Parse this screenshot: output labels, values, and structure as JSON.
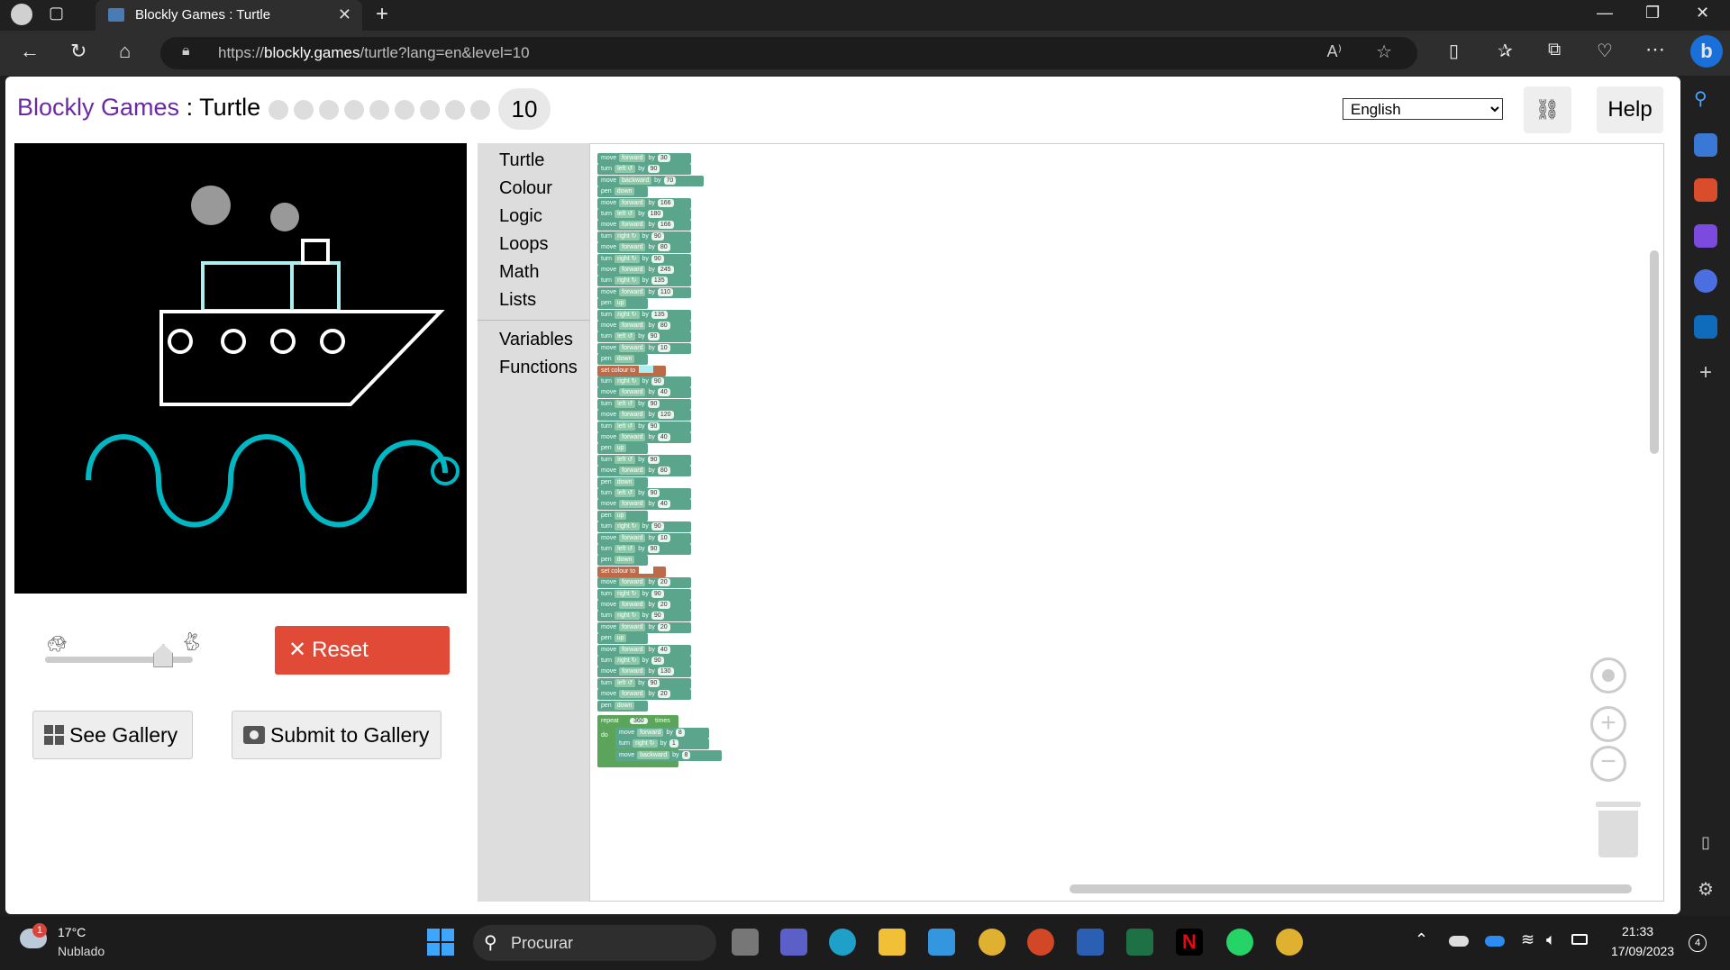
{
  "browser": {
    "tab_title": "Blockly Games : Turtle",
    "url_prefix": "https://",
    "url_domain": "blockly.games",
    "url_path": "/turtle?lang=en&level=10"
  },
  "header": {
    "games_link": "Blockly Games",
    "separator": " : ",
    "game_name": "Turtle",
    "level": "10",
    "language": "English",
    "help_label": "Help"
  },
  "controls": {
    "reset_label": "Reset",
    "see_gallery_label": "See Gallery",
    "submit_gallery_label": "Submit to Gallery",
    "speed": 0.8
  },
  "toolbox": {
    "categories": [
      "Turtle",
      "Colour",
      "Logic",
      "Loops",
      "Math",
      "Lists"
    ],
    "extra": [
      "Variables",
      "Functions"
    ]
  },
  "blocks": [
    {
      "t": "move",
      "f": "forward",
      "n": "30"
    },
    {
      "t": "turn",
      "f": "left ↺",
      "n": "90"
    },
    {
      "t": "move",
      "f": "backward",
      "n": "70"
    },
    {
      "t": "pen",
      "f": "down"
    },
    {
      "t": "move",
      "f": "forward",
      "n": "166"
    },
    {
      "t": "turn",
      "f": "left ↺",
      "n": "180"
    },
    {
      "t": "move",
      "f": "forward",
      "n": "166"
    },
    {
      "t": "turn",
      "f": "right ↻",
      "n": "90"
    },
    {
      "t": "move",
      "f": "forward",
      "n": "80"
    },
    {
      "t": "turn",
      "f": "right ↻",
      "n": "90"
    },
    {
      "t": "move",
      "f": "forward",
      "n": "245"
    },
    {
      "t": "turn",
      "f": "right ↻",
      "n": "135"
    },
    {
      "t": "move",
      "f": "forward",
      "n": "110"
    },
    {
      "t": "pen",
      "f": "up"
    },
    {
      "t": "turn",
      "f": "right ↻",
      "n": "135"
    },
    {
      "t": "move",
      "f": "forward",
      "n": "80"
    },
    {
      "t": "turn",
      "f": "left ↺",
      "n": "90"
    },
    {
      "t": "move",
      "f": "forward",
      "n": "10"
    },
    {
      "t": "pen",
      "f": "down"
    },
    {
      "t": "set colour to",
      "colour": "#aeeeee"
    },
    {
      "t": "turn",
      "f": "right ↻",
      "n": "90"
    },
    {
      "t": "move",
      "f": "forward",
      "n": "40"
    },
    {
      "t": "turn",
      "f": "left ↺",
      "n": "90"
    },
    {
      "t": "move",
      "f": "forward",
      "n": "120"
    },
    {
      "t": "turn",
      "f": "left ↺",
      "n": "90"
    },
    {
      "t": "move",
      "f": "forward",
      "n": "40"
    },
    {
      "t": "pen",
      "f": "up"
    },
    {
      "t": "turn",
      "f": "left ↺",
      "n": "90"
    },
    {
      "t": "move",
      "f": "forward",
      "n": "80"
    },
    {
      "t": "pen",
      "f": "down"
    },
    {
      "t": "turn",
      "f": "left ↺",
      "n": "90"
    },
    {
      "t": "move",
      "f": "forward",
      "n": "40"
    },
    {
      "t": "pen",
      "f": "up"
    },
    {
      "t": "turn",
      "f": "right ↻",
      "n": "90"
    },
    {
      "t": "move",
      "f": "forward",
      "n": "10"
    },
    {
      "t": "turn",
      "f": "left ↺",
      "n": "90"
    },
    {
      "t": "pen",
      "f": "down"
    },
    {
      "t": "set colour to",
      "colour": "#ffffff"
    },
    {
      "t": "move",
      "f": "forward",
      "n": "20"
    },
    {
      "t": "turn",
      "f": "right ↻",
      "n": "90"
    },
    {
      "t": "move",
      "f": "forward",
      "n": "20"
    },
    {
      "t": "turn",
      "f": "right ↻",
      "n": "90"
    },
    {
      "t": "move",
      "f": "forward",
      "n": "20"
    },
    {
      "t": "pen",
      "f": "up"
    },
    {
      "t": "move",
      "f": "forward",
      "n": "40"
    },
    {
      "t": "turn",
      "f": "right ↻",
      "n": "90"
    },
    {
      "t": "move",
      "f": "forward",
      "n": "130"
    },
    {
      "t": "turn",
      "f": "left ↺",
      "n": "90"
    },
    {
      "t": "move",
      "f": "forward",
      "n": "20"
    },
    {
      "t": "pen",
      "f": "down"
    }
  ],
  "repeat_block": {
    "label": "repeat",
    "count": "360",
    "times": "times",
    "do": "do",
    "inner": [
      {
        "t": "move",
        "f": "forward",
        "n": "8"
      },
      {
        "t": "turn",
        "f": "right ↻",
        "n": "1"
      },
      {
        "t": "move",
        "f": "backward",
        "n": "8"
      }
    ]
  },
  "taskbar": {
    "weather_temp": "17°C",
    "weather_desc": "Nublado",
    "search_placeholder": "Procurar",
    "time": "21:33",
    "date": "17/09/2023",
    "notif_count": "4",
    "weather_badge": "1"
  },
  "colors": {
    "turtle_block": "#5ba58c",
    "colour_block": "#bd6a4a",
    "loop_block": "#5ba55b",
    "reset": "#e04a36",
    "link": "#6a2aa5"
  }
}
